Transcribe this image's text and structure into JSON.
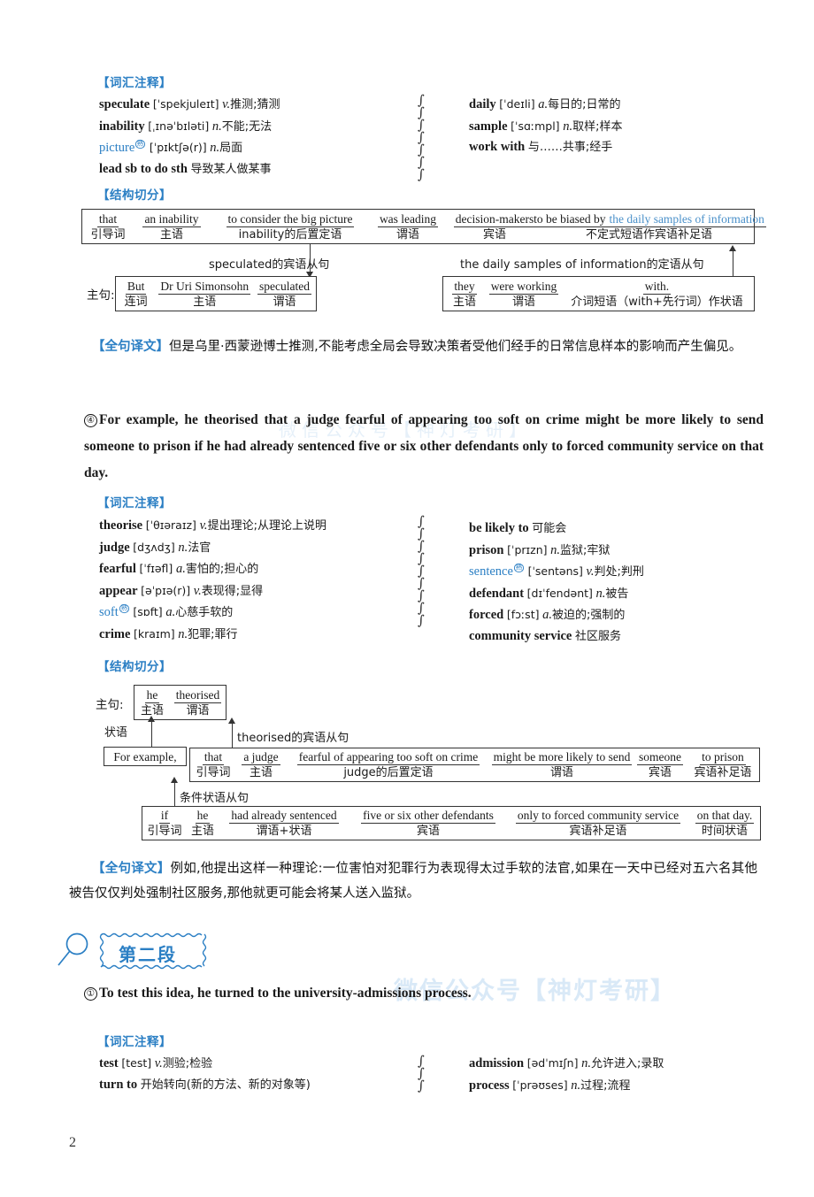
{
  "watermark": {
    "text": "微信公众号【神灯考研】"
  },
  "page": {
    "number": "2"
  },
  "labels": {
    "vocab_heading": "【词汇注释】",
    "structure_heading": "【结构切分】",
    "translation_label": "【全句译文】",
    "main_clause": "主句:"
  },
  "section1": {
    "vocab_left": [
      {
        "word": "speculate",
        "blue": false,
        "sup": "",
        "phonetic": "[ˈspekjuleɪt]",
        "pos": "v.",
        "cn": "推测;猜测"
      },
      {
        "word": "inability",
        "blue": false,
        "sup": "",
        "phonetic": "[ˌɪnəˈbɪləti]",
        "pos": "n.",
        "cn": "不能;无法"
      },
      {
        "word": "picture",
        "blue": true,
        "sup": "熟",
        "phonetic": "[ˈpɪktʃə(r)]",
        "pos": "n.",
        "cn": "局面"
      },
      {
        "word": "lead sb to do sth",
        "blue": false,
        "sup": "",
        "phonetic": "",
        "pos": "",
        "cn": "导致某人做某事"
      }
    ],
    "vocab_right": [
      {
        "word": "daily",
        "blue": false,
        "sup": "",
        "phonetic": "[ˈdeɪli]",
        "pos": "a.",
        "cn": "每日的;日常的"
      },
      {
        "word": "sample",
        "blue": false,
        "sup": "",
        "phonetic": "[ˈsɑːmpl]",
        "pos": "n.",
        "cn": "取样;样本"
      },
      {
        "word": "work with",
        "blue": false,
        "sup": "",
        "phonetic": "",
        "pos": "",
        "cn": "与……共事;经手"
      }
    ],
    "structure": {
      "top_box": [
        {
          "en": "that",
          "cn": "引导词",
          "blue": false
        },
        {
          "en": "an inability",
          "cn": "主语",
          "blue": false
        },
        {
          "en": "to consider the big picture",
          "cn": "inability的后置定语",
          "blue": false
        },
        {
          "en": "was leading",
          "cn": "谓语",
          "blue": false
        },
        {
          "en": "decision-makers",
          "cn": "宾语",
          "blue": false
        },
        {
          "en": "to be biased by",
          "cn": "",
          "blue": false
        },
        {
          "en": "the daily samples of information",
          "cn": "不定式短语作宾语补足语",
          "blue": true
        }
      ],
      "note_left": "speculated的宾语从句",
      "note_right": "the daily samples of information的定语从句",
      "main_box": [
        {
          "en": "But",
          "cn": "连词"
        },
        {
          "en": "Dr Uri Simonsohn",
          "cn": "主语"
        },
        {
          "en": "speculated",
          "cn": "谓语"
        }
      ],
      "rel_box": [
        {
          "en": "they",
          "cn": "主语"
        },
        {
          "en": "were working",
          "cn": "谓语"
        },
        {
          "en": "with.",
          "cn": "介词短语（with+先行词）作状语"
        }
      ]
    },
    "translation": "但是乌里·西蒙逊博士推测,不能考虑全局会导致决策者受他们经手的日常信息样本的影响而产生偏见。"
  },
  "section2": {
    "number": "④",
    "english": "For example, he theorised that a judge fearful of appearing too soft on crime might be more likely to send someone to prison if he had already sentenced five or six other defendants only to forced community service on that day.",
    "vocab_left": [
      {
        "word": "theorise",
        "blue": false,
        "sup": "",
        "phonetic": "[ˈθɪəraɪz]",
        "pos": "v.",
        "cn": "提出理论;从理论上说明"
      },
      {
        "word": "judge",
        "blue": false,
        "sup": "",
        "phonetic": "[dʒʌdʒ]",
        "pos": "n.",
        "cn": "法官"
      },
      {
        "word": "fearful",
        "blue": false,
        "sup": "",
        "phonetic": "[ˈfɪəfl]",
        "pos": "a.",
        "cn": "害怕的;担心的"
      },
      {
        "word": "appear",
        "blue": false,
        "sup": "",
        "phonetic": "[əˈpɪə(r)]",
        "pos": "v.",
        "cn": "表现得;显得"
      },
      {
        "word": "soft",
        "blue": true,
        "sup": "熟",
        "phonetic": "[sɒft]",
        "pos": "a.",
        "cn": "心慈手软的"
      },
      {
        "word": "crime",
        "blue": false,
        "sup": "",
        "phonetic": "[kraɪm]",
        "pos": "n.",
        "cn": "犯罪;罪行"
      }
    ],
    "vocab_right": [
      {
        "word": "be likely to",
        "blue": false,
        "sup": "",
        "phonetic": "",
        "pos": "",
        "cn": "可能会"
      },
      {
        "word": "prison",
        "blue": false,
        "sup": "",
        "phonetic": "[ˈprɪzn]",
        "pos": "n.",
        "cn": "监狱;牢狱"
      },
      {
        "word": "sentence",
        "blue": true,
        "sup": "熟",
        "phonetic": "[ˈsentəns]",
        "pos": "v.",
        "cn": "判处;判刑"
      },
      {
        "word": "defendant",
        "blue": false,
        "sup": "",
        "phonetic": "[dɪˈfendənt]",
        "pos": "n.",
        "cn": "被告"
      },
      {
        "word": "forced",
        "blue": false,
        "sup": "",
        "phonetic": "[fɔːst]",
        "pos": "a.",
        "cn": "被迫的;强制的"
      },
      {
        "word": "community service",
        "blue": false,
        "sup": "",
        "phonetic": "",
        "pos": "",
        "cn": "社区服务"
      }
    ],
    "structure": {
      "main_box": [
        {
          "en": "he",
          "cn": "主语"
        },
        {
          "en": "theorised",
          "cn": "谓语"
        }
      ],
      "adverbial_label": "状语",
      "adverbial_box": "For example,",
      "note_object": "theorised的宾语从句",
      "obj_box": [
        {
          "en": "that",
          "cn": "引导词"
        },
        {
          "en": "a judge",
          "cn": "主语"
        },
        {
          "en": "fearful of appearing too soft on crime",
          "cn": "judge的后置定语"
        },
        {
          "en": "might be more likely to send",
          "cn": "谓语"
        },
        {
          "en": "someone",
          "cn": "宾语"
        },
        {
          "en": "to prison",
          "cn": "宾语补足语"
        }
      ],
      "note_condition": "条件状语从句",
      "cond_box": [
        {
          "en": "if",
          "cn": "引导词"
        },
        {
          "en": "he",
          "cn": "主语"
        },
        {
          "en": "had already sentenced",
          "cn": "谓语+状语"
        },
        {
          "en": "five or six other defendants",
          "cn": "宾语"
        },
        {
          "en": "only to forced community service",
          "cn": "宾语补足语"
        },
        {
          "en": "on that day.",
          "cn": "时间状语"
        }
      ]
    },
    "translation": "例如,他提出这样一种理论:一位害怕对犯罪行为表现得太过手软的法官,如果在一天中已经对五六名其他被告仅仅判处强制社区服务,那他就更可能会将某人送入监狱。"
  },
  "section3": {
    "para_marker": "第二段",
    "number": "①",
    "english": "To test this idea, he turned to the university-admissions process.",
    "vocab_left": [
      {
        "word": "test",
        "blue": false,
        "sup": "",
        "phonetic": "[test]",
        "pos": "v.",
        "cn": "测验;检验"
      },
      {
        "word": "turn to",
        "blue": false,
        "sup": "",
        "phonetic": "",
        "pos": "",
        "cn": "开始转向(新的方法、新的对象等)"
      }
    ],
    "vocab_right": [
      {
        "word": "admission",
        "blue": false,
        "sup": "",
        "phonetic": "[ədˈmɪʃn]",
        "pos": "n.",
        "cn": "允许进入;录取"
      },
      {
        "word": "process",
        "blue": false,
        "sup": "",
        "phonetic": "[ˈprəʊses]",
        "pos": "n.",
        "cn": "过程;流程"
      }
    ]
  },
  "colors": {
    "accent": "#2b7fc4",
    "watermark": "#d9e9f7",
    "ink": "#1a1a1a"
  }
}
